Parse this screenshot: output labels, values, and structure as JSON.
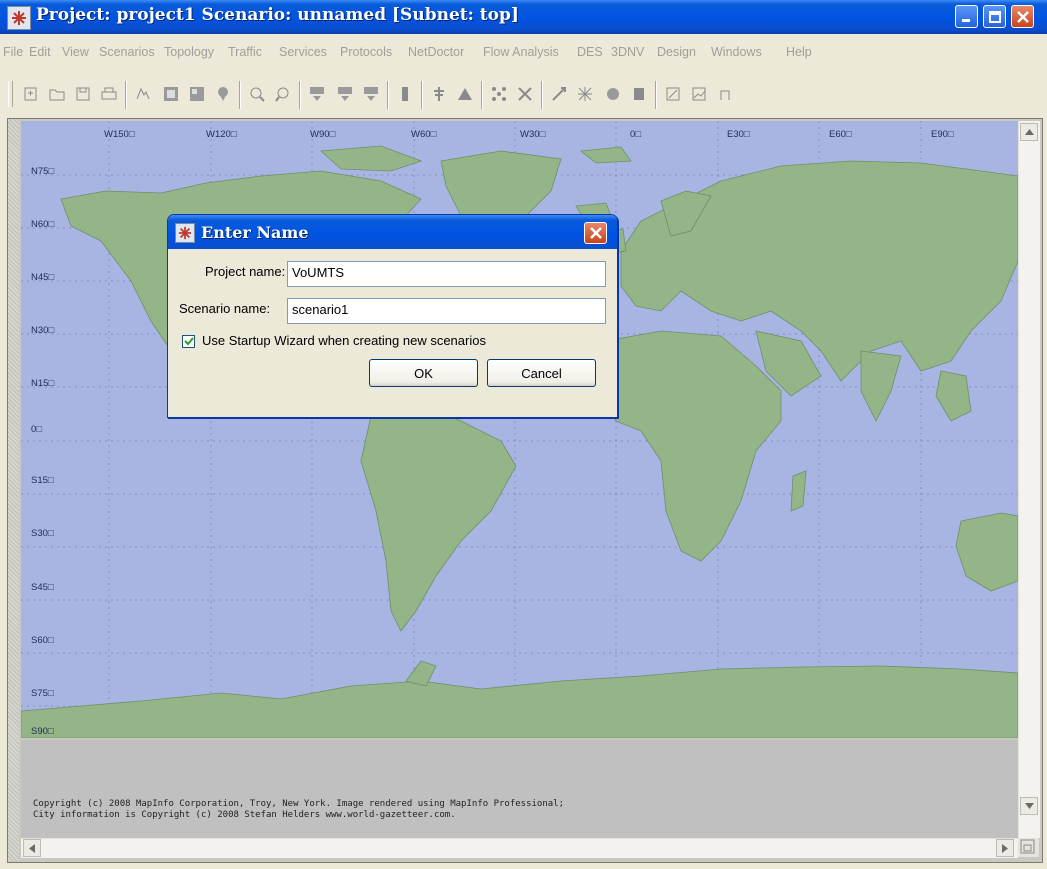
{
  "window": {
    "title": "Project: project1 Scenario: unnamed  [Subnet: top]"
  },
  "menu": [
    {
      "label": "File",
      "enabled": false
    },
    {
      "label": "Edit",
      "enabled": false
    },
    {
      "label": "View",
      "enabled": false
    },
    {
      "label": "Scenarios",
      "enabled": false
    },
    {
      "label": "Topology",
      "enabled": false
    },
    {
      "label": "Traffic",
      "enabled": false
    },
    {
      "label": "Services",
      "enabled": false
    },
    {
      "label": "Protocols",
      "enabled": false
    },
    {
      "label": "NetDoctor",
      "enabled": false
    },
    {
      "label": "Flow Analysis",
      "enabled": false
    },
    {
      "label": "DES",
      "enabled": false
    },
    {
      "label": "3DNV",
      "enabled": false
    },
    {
      "label": "Design",
      "enabled": false
    },
    {
      "label": "Windows",
      "enabled": false
    },
    {
      "label": "Help",
      "enabled": false
    }
  ],
  "map": {
    "longitude_labels": [
      "W150□",
      "W120□",
      "W90□",
      "W60□",
      "W30□",
      "0□",
      "E30□",
      "E60□",
      "E90□"
    ],
    "latitude_labels": [
      "N75□",
      "N60□",
      "N45□",
      "N30□",
      "N15□",
      "0□",
      "S15□",
      "S30□",
      "S45□",
      "S60□",
      "S75□",
      "S90□"
    ],
    "ocean_color": "#a8b5e3",
    "land_color": "#93b587",
    "copyright_lines": [
      "Copyright (c) 2008 MapInfo Corporation, Troy, New York. Image rendered using MapInfo Professional;",
      "City information is Copyright (c) 2008 Stefan Helders www.world-gazetteer.com."
    ]
  },
  "dialog": {
    "title": "Enter Name",
    "project_name_label": "Project name:",
    "project_name_value": "VoUMTS",
    "scenario_name_label": "Scenario name:",
    "scenario_name_value": "scenario1",
    "startup_wizard_label": "Use Startup Wizard when creating new scenarios",
    "startup_wizard_checked": true,
    "ok_label": "OK",
    "cancel_label": "Cancel"
  }
}
